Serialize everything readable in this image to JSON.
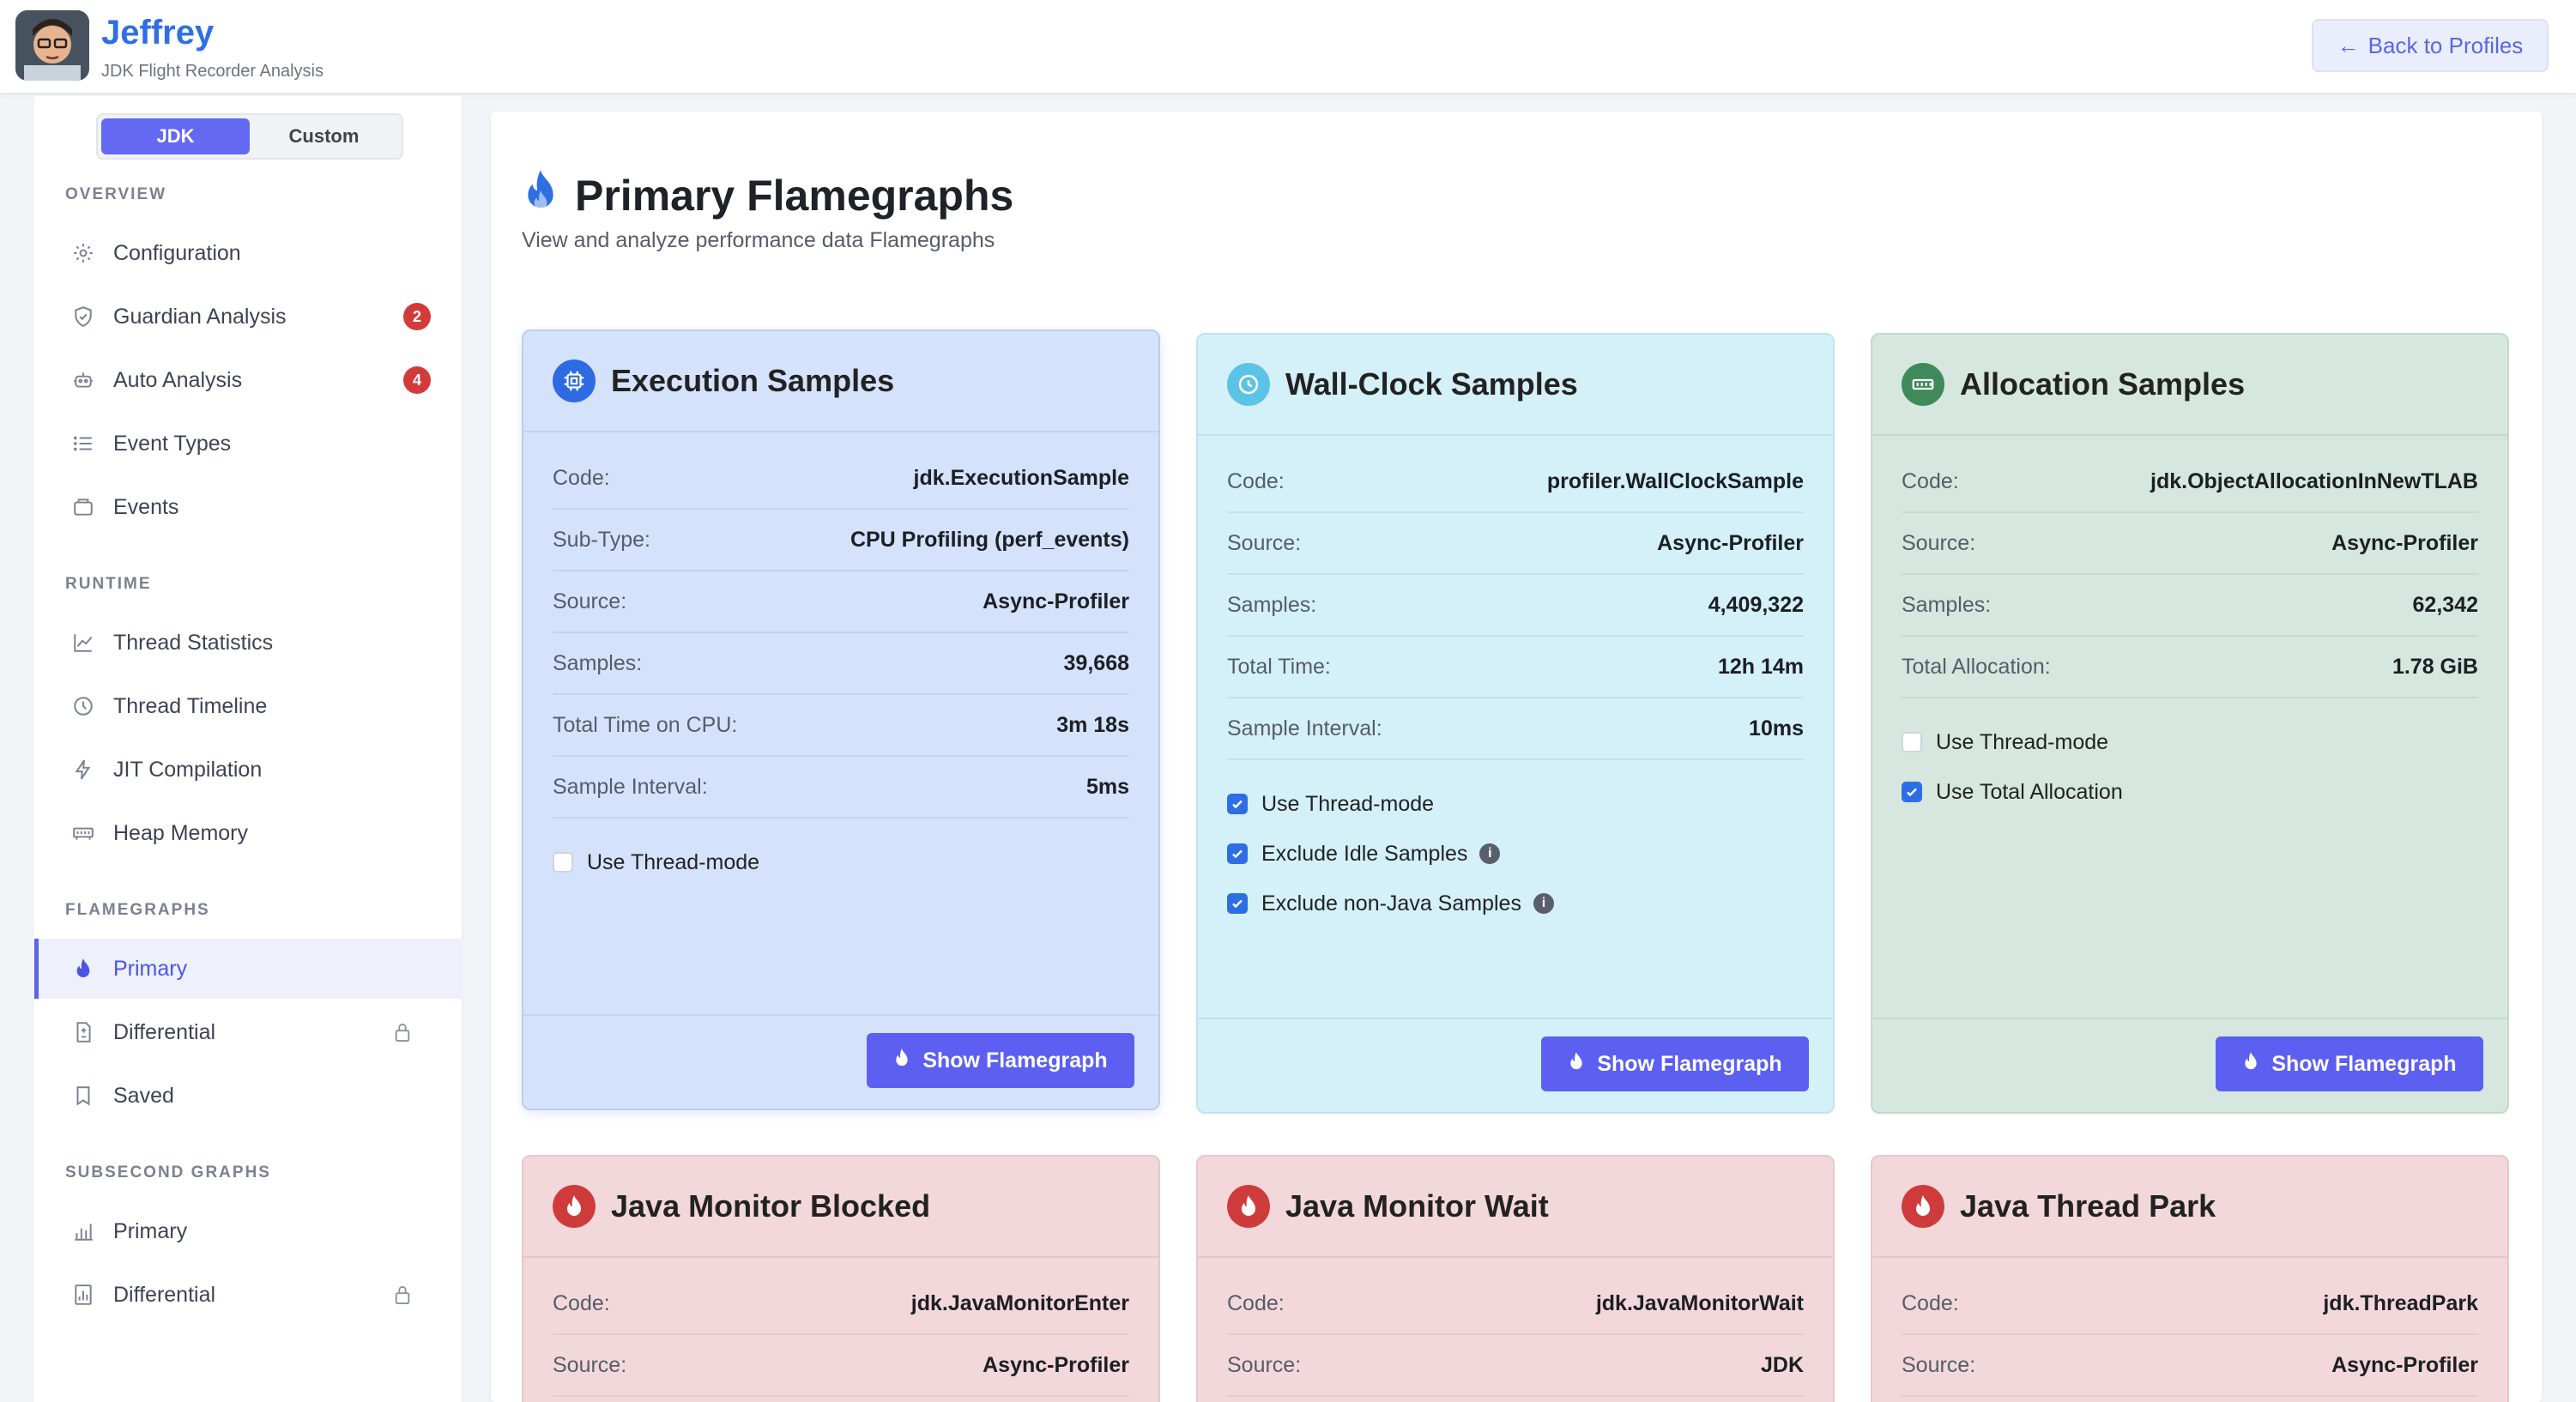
{
  "header": {
    "title": "Jeffrey",
    "subtitle": "JDK Flight Recorder Analysis",
    "back_label": "Back to Profiles"
  },
  "sidebar": {
    "toggle": {
      "options": [
        "JDK",
        "Custom"
      ],
      "selected": "JDK"
    },
    "sections": [
      {
        "label": "OVERVIEW",
        "items": [
          {
            "label": "Configuration",
            "icon": "gear-icon"
          },
          {
            "label": "Guardian Analysis",
            "icon": "shield-icon",
            "badge": "2"
          },
          {
            "label": "Auto Analysis",
            "icon": "robot-icon",
            "badge": "4"
          },
          {
            "label": "Event Types",
            "icon": "list-icon"
          },
          {
            "label": "Events",
            "icon": "folder-icon"
          }
        ]
      },
      {
        "label": "RUNTIME",
        "items": [
          {
            "label": "Thread Statistics",
            "icon": "line-chart-icon"
          },
          {
            "label": "Thread Timeline",
            "icon": "clock-icon"
          },
          {
            "label": "JIT Compilation",
            "icon": "lightning-icon"
          },
          {
            "label": "Heap Memory",
            "icon": "memory-icon"
          }
        ]
      },
      {
        "label": "FLAMEGRAPHS",
        "items": [
          {
            "label": "Primary",
            "icon": "flame-icon",
            "active": true
          },
          {
            "label": "Differential",
            "icon": "file-diff-icon",
            "locked": true
          },
          {
            "label": "Saved",
            "icon": "bookmark-icon"
          }
        ]
      },
      {
        "label": "SUBSECOND GRAPHS",
        "items": [
          {
            "label": "Primary",
            "icon": "bar-chart-icon"
          },
          {
            "label": "Differential",
            "icon": "bar-chart-file-icon",
            "locked": true
          }
        ]
      }
    ]
  },
  "page": {
    "title": "Primary Flamegraphs",
    "subtitle": "View and analyze performance data Flamegraphs"
  },
  "cards": [
    {
      "title": "Execution Samples",
      "icon": "cpu-icon",
      "bg": "#d5e2fb",
      "icon_bg": "#2d6be3",
      "rows": [
        {
          "k": "Code:",
          "v": "jdk.ExecutionSample"
        },
        {
          "k": "Sub-Type:",
          "v": "CPU Profiling (perf_events)"
        },
        {
          "k": "Source:",
          "v": "Async-Profiler"
        },
        {
          "k": "Samples:",
          "v": "39,668"
        },
        {
          "k": "Total Time on CPU:",
          "v": "3m 18s"
        },
        {
          "k": "Sample Interval:",
          "v": "5ms"
        }
      ],
      "options": [
        {
          "label": "Use Thread-mode",
          "checked": false
        }
      ],
      "button": "Show Flamegraph"
    },
    {
      "title": "Wall-Clock Samples",
      "icon": "clock-icon",
      "bg": "#d4f0f8",
      "icon_bg": "#5bc3e6",
      "rows": [
        {
          "k": "Code:",
          "v": "profiler.WallClockSample"
        },
        {
          "k": "Source:",
          "v": "Async-Profiler"
        },
        {
          "k": "Samples:",
          "v": "4,409,322"
        },
        {
          "k": "Total Time:",
          "v": "12h 14m"
        },
        {
          "k": "Sample Interval:",
          "v": "10ms"
        }
      ],
      "options": [
        {
          "label": "Use Thread-mode",
          "checked": true
        },
        {
          "label": "Exclude Idle Samples",
          "checked": true,
          "info": true
        },
        {
          "label": "Exclude non-Java Samples",
          "checked": true,
          "info": true
        }
      ],
      "button": "Show Flamegraph"
    },
    {
      "title": "Allocation Samples",
      "icon": "memory-icon",
      "bg": "#d6e7df",
      "icon_bg": "#3f8a5a",
      "rows": [
        {
          "k": "Code:",
          "v": "jdk.ObjectAllocationInNewTLAB"
        },
        {
          "k": "Source:",
          "v": "Async-Profiler"
        },
        {
          "k": "Samples:",
          "v": "62,342"
        },
        {
          "k": "Total Allocation:",
          "v": "1.78 GiB"
        }
      ],
      "options": [
        {
          "label": "Use Thread-mode",
          "checked": false
        },
        {
          "label": "Use Total Allocation",
          "checked": true
        }
      ],
      "button": "Show Flamegraph"
    },
    {
      "title": "Java Monitor Blocked",
      "icon": "flame-icon",
      "bg": "#f3d8db",
      "icon_bg": "#cf3b3b",
      "rows": [
        {
          "k": "Code:",
          "v": "jdk.JavaMonitorEnter"
        },
        {
          "k": "Source:",
          "v": "Async-Profiler"
        }
      ],
      "options": [],
      "button": ""
    },
    {
      "title": "Java Monitor Wait",
      "icon": "flame-icon",
      "bg": "#f3d8db",
      "icon_bg": "#cf3b3b",
      "rows": [
        {
          "k": "Code:",
          "v": "jdk.JavaMonitorWait"
        },
        {
          "k": "Source:",
          "v": "JDK"
        }
      ],
      "options": [],
      "button": ""
    },
    {
      "title": "Java Thread Park",
      "icon": "flame-icon",
      "bg": "#f3d8db",
      "icon_bg": "#cf3b3b",
      "rows": [
        {
          "k": "Code:",
          "v": "jdk.ThreadPark"
        },
        {
          "k": "Source:",
          "v": "Async-Profiler"
        }
      ],
      "options": [],
      "button": ""
    }
  ]
}
